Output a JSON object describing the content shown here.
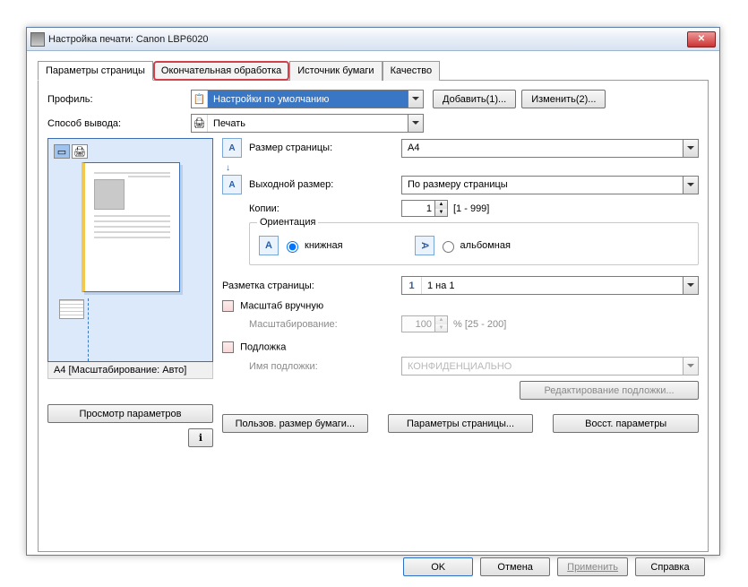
{
  "window": {
    "title": "Настройка печати: Canon LBP6020"
  },
  "tabs": [
    "Параметры страницы",
    "Окончательная обработка",
    "Источник бумаги",
    "Качество"
  ],
  "profile": {
    "label": "Профиль:",
    "value": "Настройки по умолчанию",
    "add_btn": "Добавить(1)...",
    "edit_btn": "Изменить(2)..."
  },
  "output_method": {
    "label": "Способ вывода:",
    "value": "Печать"
  },
  "preview": {
    "caption": "A4 [Масштабирование: Авто]",
    "view_settings_btn": "Просмотр параметров"
  },
  "page_size": {
    "label": "Размер страницы:",
    "value": "A4"
  },
  "output_size": {
    "label": "Выходной размер:",
    "value": "По размеру страницы"
  },
  "copies": {
    "label": "Копии:",
    "value": "1",
    "range": "[1 - 999]"
  },
  "orientation": {
    "group_label": "Ориентация",
    "portrait": "книжная",
    "landscape": "альбомная"
  },
  "layout": {
    "label": "Разметка страницы:",
    "value": "1 на 1",
    "icon_text": "1"
  },
  "manual_scale": {
    "checkbox": "Масштаб вручную",
    "scale_label": "Масштабирование:",
    "scale_value": "100",
    "scale_suffix": "% [25 - 200]"
  },
  "watermark": {
    "checkbox": "Подложка",
    "name_label": "Имя подложки:",
    "name_value": "КОНФИДЕНЦИАЛЬНО",
    "edit_btn": "Редактирование подложки..."
  },
  "bottom_buttons": {
    "custom_size": "Пользов. размер бумаги...",
    "page_options": "Параметры страницы...",
    "restore": "Восст. параметры"
  },
  "dialog_buttons": {
    "ok": "OK",
    "cancel": "Отмена",
    "apply": "Применить",
    "help": "Справка"
  }
}
